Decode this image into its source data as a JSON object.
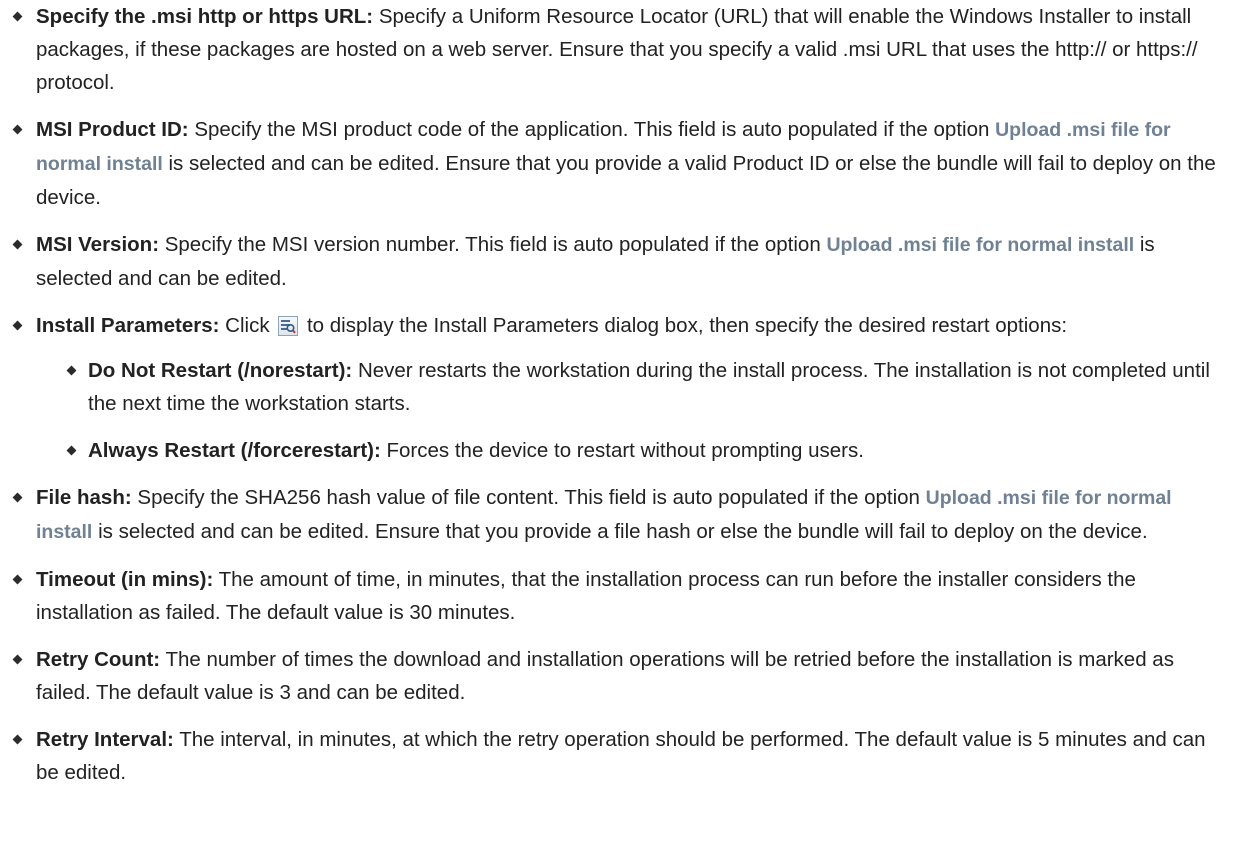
{
  "items": [
    {
      "term": "Specify the .msi http or https URL:",
      "text": "Specify a Uniform Resource Locator (URL) that will enable the Windows Installer to install packages, if these packages are hosted on a web server. Ensure that you specify a valid .msi URL that uses the http:// or https:// protocol."
    },
    {
      "term": "MSI Product ID:",
      "text_a": "Specify the MSI product code of the application. This field is auto populated if the option",
      "ui_ref": "Upload .msi file for normal install",
      "text_b": "is selected and can be edited. Ensure that you provide a valid Product ID or else the bundle will fail to deploy on the device."
    },
    {
      "term": "MSI Version:",
      "text_a": "Specify the MSI version number. This field is auto populated if the option",
      "ui_ref": "Upload .msi file for normal install",
      "text_b": "is selected and can be edited."
    },
    {
      "term": "Install Parameters:",
      "text_a": "Click",
      "icon": "install-parameters-icon",
      "text_b": "to display the Install Parameters dialog box, then specify the desired restart options:",
      "sub": [
        {
          "term": "Do Not Restart (/norestart):",
          "text": "Never restarts the workstation during the install process. The installation is not completed until the next time the workstation starts."
        },
        {
          "term": "Always Restart (/forcerestart):",
          "text": "Forces the device to restart without prompting users."
        }
      ]
    },
    {
      "term": "File hash:",
      "text_a": "Specify the SHA256 hash value of file content. This field is auto populated if the option",
      "ui_ref": "Upload .msi file for normal install",
      "text_b": "is selected and can be edited. Ensure that you provide a file hash or else the bundle will fail to deploy on the device."
    },
    {
      "term": "Timeout (in mins):",
      "text": "The amount of time, in minutes, that the installation process can run before the installer considers the installation as failed. The default value is 30 minutes."
    },
    {
      "term": "Retry Count:",
      "text": "The number of times the download and installation operations will be retried before the installation is marked as failed. The default value is 3 and can be edited."
    },
    {
      "term": "Retry Interval:",
      "text": "The interval, in minutes, at which the retry operation should be performed. The default value is 5 minutes and can be edited."
    }
  ],
  "colors": {
    "text": "#222222",
    "ui_reference": "#6f8193",
    "bullet": "#2b2b2b"
  }
}
